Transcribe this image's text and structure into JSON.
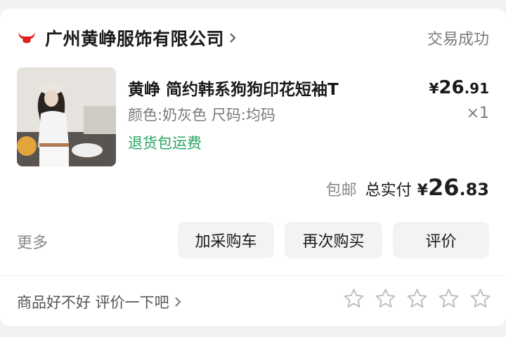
{
  "shop": {
    "name": "广州黄峥服饰有限公司",
    "status": "交易成功"
  },
  "product": {
    "title": "黄峥 简约韩系狗狗印花短袖T",
    "spec": "颜色:奶灰色 尺码:均码",
    "tag": "退货包运费",
    "price_symbol": "¥",
    "price_int": "26",
    "price_dec": ".91",
    "quantity": "×1"
  },
  "total": {
    "shipping_note": "包邮",
    "label": "总实付",
    "symbol": "¥",
    "int": "26",
    "dec": ".83"
  },
  "actions": {
    "more": "更多",
    "add_cart": "加采购车",
    "rebuy": "再次购买",
    "review": "评价"
  },
  "review_prompt": {
    "text": "商品好不好 评价一下吧",
    "stars_total": 5,
    "stars_filled": 0
  },
  "icons": {
    "shop_logo": "bull-logo-icon",
    "chevron": "chevron-right-icon",
    "star": "star-outline-icon"
  },
  "colors": {
    "brand_red": "#e02020",
    "return_tag_green": "#27a563",
    "muted_text": "#7a7a7a",
    "button_bg": "#f3f3f3"
  }
}
